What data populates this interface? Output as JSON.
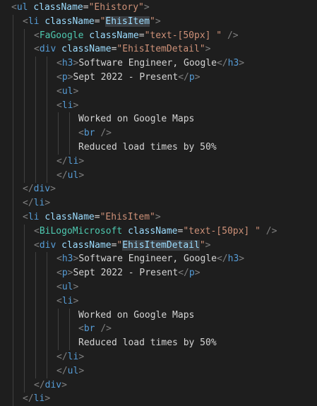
{
  "editor": {
    "colors": {
      "background": "#1e1e1e",
      "punct": "#808080",
      "tag": "#569cd6",
      "component": "#4ec9b0",
      "attr": "#9cdcfe",
      "string": "#ce9178",
      "text": "#d4d4d4"
    },
    "lines": [
      {
        "indent": 0,
        "tokens": [
          [
            "punct",
            "<"
          ],
          [
            "tag",
            "ul"
          ],
          [
            "text",
            " "
          ],
          [
            "attr",
            "className"
          ],
          [
            "eq",
            "="
          ],
          [
            "str",
            "\"Ehistory\""
          ],
          [
            "punct",
            ">"
          ]
        ]
      },
      {
        "indent": 1,
        "tokens": [
          [
            "punct",
            "<"
          ],
          [
            "tag",
            "li"
          ],
          [
            "text",
            " "
          ],
          [
            "attr",
            "className"
          ],
          [
            "eq",
            "="
          ],
          [
            "str",
            "\""
          ],
          [
            "hl",
            "EhisItem"
          ],
          [
            "str",
            "\""
          ],
          [
            "punct",
            ">"
          ]
        ]
      },
      {
        "indent": 2,
        "tokens": [
          [
            "punct",
            "<"
          ],
          [
            "comp",
            "FaGoogle"
          ],
          [
            "text",
            " "
          ],
          [
            "attr",
            "className"
          ],
          [
            "eq",
            "="
          ],
          [
            "str",
            "\"text-[50px] \""
          ],
          [
            "text",
            " "
          ],
          [
            "punct",
            "/>"
          ]
        ]
      },
      {
        "indent": 2,
        "tokens": [
          [
            "punct",
            "<"
          ],
          [
            "tag",
            "div"
          ],
          [
            "text",
            " "
          ],
          [
            "attr",
            "className"
          ],
          [
            "eq",
            "="
          ],
          [
            "str",
            "\"EhisItemDetail\""
          ],
          [
            "punct",
            ">"
          ]
        ]
      },
      {
        "indent": 4,
        "tokens": [
          [
            "punct",
            "<"
          ],
          [
            "tag",
            "h3"
          ],
          [
            "punct",
            ">"
          ],
          [
            "text",
            "Software Engineer, Google"
          ],
          [
            "punct",
            "</"
          ],
          [
            "tag",
            "h3"
          ],
          [
            "punct",
            ">"
          ]
        ]
      },
      {
        "indent": 4,
        "tokens": [
          [
            "punct",
            "<"
          ],
          [
            "tag",
            "p"
          ],
          [
            "punct",
            ">"
          ],
          [
            "text",
            "Sept 2022 - Present"
          ],
          [
            "punct",
            "</"
          ],
          [
            "tag",
            "p"
          ],
          [
            "punct",
            ">"
          ]
        ]
      },
      {
        "indent": 4,
        "tokens": [
          [
            "punct",
            "<"
          ],
          [
            "tag",
            "ul"
          ],
          [
            "punct",
            ">"
          ]
        ]
      },
      {
        "indent": 4,
        "tokens": [
          [
            "punct",
            "<"
          ],
          [
            "tag",
            "li"
          ],
          [
            "punct",
            ">"
          ]
        ]
      },
      {
        "indent": 6,
        "tokens": [
          [
            "text",
            "Worked on Google Maps"
          ]
        ]
      },
      {
        "indent": 6,
        "tokens": [
          [
            "punct",
            "<"
          ],
          [
            "tag",
            "br"
          ],
          [
            "text",
            " "
          ],
          [
            "punct",
            "/>"
          ]
        ]
      },
      {
        "indent": 6,
        "tokens": [
          [
            "text",
            "Reduced load times by 50%"
          ]
        ]
      },
      {
        "indent": 4,
        "tokens": [
          [
            "punct",
            "</"
          ],
          [
            "tag",
            "li"
          ],
          [
            "punct",
            ">"
          ]
        ]
      },
      {
        "indent": 4,
        "tokens": [
          [
            "punct",
            "</"
          ],
          [
            "tag",
            "ul"
          ],
          [
            "punct",
            ">"
          ]
        ]
      },
      {
        "indent": 1,
        "tokens": [
          [
            "punct",
            "</"
          ],
          [
            "tag",
            "div"
          ],
          [
            "punct",
            ">"
          ]
        ]
      },
      {
        "indent": 1,
        "tokens": [
          [
            "punct",
            "</"
          ],
          [
            "tag",
            "li"
          ],
          [
            "punct",
            ">"
          ]
        ]
      },
      {
        "indent": 1,
        "tokens": [
          [
            "punct",
            "<"
          ],
          [
            "tag",
            "li"
          ],
          [
            "text",
            " "
          ],
          [
            "attr",
            "className"
          ],
          [
            "eq",
            "="
          ],
          [
            "str",
            "\"EhisItem\""
          ],
          [
            "punct",
            ">"
          ]
        ]
      },
      {
        "indent": 2,
        "tokens": [
          [
            "punct",
            "<"
          ],
          [
            "comp",
            "BiLogoMicrosoft"
          ],
          [
            "text",
            " "
          ],
          [
            "attr",
            "className"
          ],
          [
            "eq",
            "="
          ],
          [
            "str",
            "\"text-[50px] \""
          ],
          [
            "text",
            " "
          ],
          [
            "punct",
            "/>"
          ]
        ]
      },
      {
        "indent": 2,
        "tokens": [
          [
            "punct",
            "<"
          ],
          [
            "tag",
            "div"
          ],
          [
            "text",
            " "
          ],
          [
            "attr",
            "className"
          ],
          [
            "eq",
            "="
          ],
          [
            "str",
            "\""
          ],
          [
            "hl",
            "EhisItemDetail"
          ],
          [
            "str",
            "\""
          ],
          [
            "punct",
            ">"
          ]
        ]
      },
      {
        "indent": 4,
        "tokens": [
          [
            "punct",
            "<"
          ],
          [
            "tag",
            "h3"
          ],
          [
            "punct",
            ">"
          ],
          [
            "text",
            "Software Engineer, Google"
          ],
          [
            "punct",
            "</"
          ],
          [
            "tag",
            "h3"
          ],
          [
            "punct",
            ">"
          ]
        ]
      },
      {
        "indent": 4,
        "tokens": [
          [
            "punct",
            "<"
          ],
          [
            "tag",
            "p"
          ],
          [
            "punct",
            ">"
          ],
          [
            "text",
            "Sept 2022 - Present"
          ],
          [
            "punct",
            "</"
          ],
          [
            "tag",
            "p"
          ],
          [
            "punct",
            ">"
          ]
        ]
      },
      {
        "indent": 4,
        "tokens": [
          [
            "punct",
            "<"
          ],
          [
            "tag",
            "ul"
          ],
          [
            "punct",
            ">"
          ]
        ]
      },
      {
        "indent": 4,
        "tokens": [
          [
            "punct",
            "<"
          ],
          [
            "tag",
            "li"
          ],
          [
            "punct",
            ">"
          ]
        ]
      },
      {
        "indent": 6,
        "tokens": [
          [
            "text",
            "Worked on Google Maps"
          ]
        ]
      },
      {
        "indent": 6,
        "tokens": [
          [
            "punct",
            "<"
          ],
          [
            "tag",
            "br"
          ],
          [
            "text",
            " "
          ],
          [
            "punct",
            "/>"
          ]
        ]
      },
      {
        "indent": 6,
        "tokens": [
          [
            "text",
            "Reduced load times by 50%"
          ]
        ]
      },
      {
        "indent": 4,
        "tokens": [
          [
            "punct",
            "</"
          ],
          [
            "tag",
            "li"
          ],
          [
            "punct",
            ">"
          ]
        ]
      },
      {
        "indent": 4,
        "tokens": [
          [
            "punct",
            "</"
          ],
          [
            "tag",
            "ul"
          ],
          [
            "punct",
            ">"
          ]
        ]
      },
      {
        "indent": 2,
        "tokens": [
          [
            "punct",
            "</"
          ],
          [
            "tag",
            "div"
          ],
          [
            "punct",
            ">"
          ]
        ]
      },
      {
        "indent": 1,
        "tokens": [
          [
            "punct",
            "</"
          ],
          [
            "tag",
            "li"
          ],
          [
            "punct",
            ">"
          ]
        ]
      }
    ]
  }
}
